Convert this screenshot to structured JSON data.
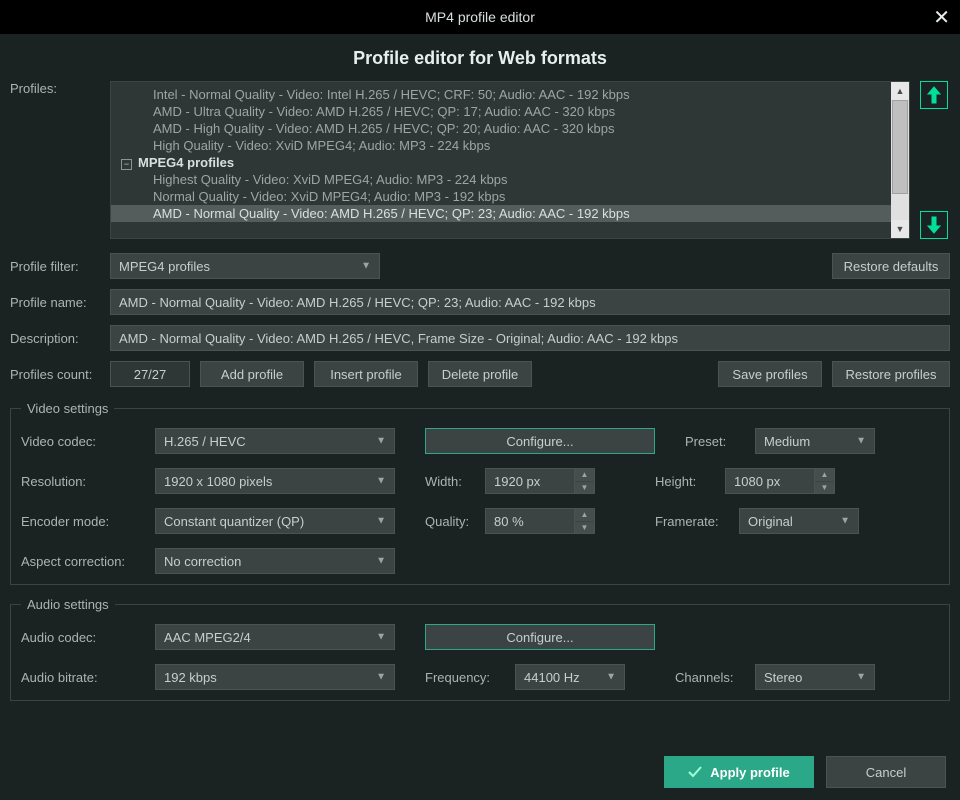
{
  "window": {
    "title": "MP4 profile editor"
  },
  "subtitle": "Profile editor for Web formats",
  "labels": {
    "profiles": "Profiles:",
    "profile_filter": "Profile filter:",
    "profile_name": "Profile name:",
    "description": "Description:",
    "profiles_count": "Profiles count:"
  },
  "tree": {
    "lines": [
      "Intel - Normal Quality - Video: Intel H.265 / HEVC; CRF: 50; Audio: AAC - 192 kbps",
      "AMD - Ultra Quality - Video: AMD H.265 / HEVC; QP: 17; Audio: AAC - 320 kbps",
      "AMD - High Quality - Video: AMD H.265 / HEVC; QP: 20; Audio: AAC - 320 kbps",
      "High Quality - Video: XviD MPEG4; Audio: MP3 - 224 kbps"
    ],
    "group": "MPEG4 profiles",
    "sub": [
      "Highest Quality - Video: XviD MPEG4; Audio: MP3 - 224 kbps",
      "Normal Quality - Video: XviD MPEG4; Audio: MP3 - 192 kbps",
      "AMD - Normal Quality - Video: AMD H.265 / HEVC; QP: 23; Audio: AAC - 192 kbps"
    ]
  },
  "filter": "MPEG4 profiles",
  "profile_name": "AMD - Normal Quality - Video: AMD H.265 / HEVC; QP: 23; Audio: AAC - 192 kbps",
  "description": "AMD - Normal Quality - Video: AMD H.265 / HEVC, Frame Size - Original; Audio: AAC - 192 kbps",
  "count": "27/27",
  "buttons": {
    "restore_defaults": "Restore defaults",
    "add": "Add profile",
    "insert": "Insert profile",
    "delete": "Delete profile",
    "save": "Save profiles",
    "restore": "Restore profiles",
    "configure": "Configure...",
    "apply": "Apply profile",
    "cancel": "Cancel"
  },
  "video": {
    "legend": "Video settings",
    "codec_label": "Video codec:",
    "codec": "H.265 / HEVC",
    "preset_label": "Preset:",
    "preset": "Medium",
    "resolution_label": "Resolution:",
    "resolution": "1920 x 1080 pixels",
    "width_label": "Width:",
    "width": "1920 px",
    "height_label": "Height:",
    "height": "1080 px",
    "encoder_label": "Encoder mode:",
    "encoder": "Constant quantizer (QP)",
    "quality_label": "Quality:",
    "quality": "80 %",
    "framerate_label": "Framerate:",
    "framerate": "Original",
    "aspect_label": "Aspect correction:",
    "aspect": "No correction"
  },
  "audio": {
    "legend": "Audio settings",
    "codec_label": "Audio codec:",
    "codec": "AAC MPEG2/4",
    "bitrate_label": "Audio bitrate:",
    "bitrate": "192 kbps",
    "frequency_label": "Frequency:",
    "frequency": "44100 Hz",
    "channels_label": "Channels:",
    "channels": "Stereo"
  }
}
